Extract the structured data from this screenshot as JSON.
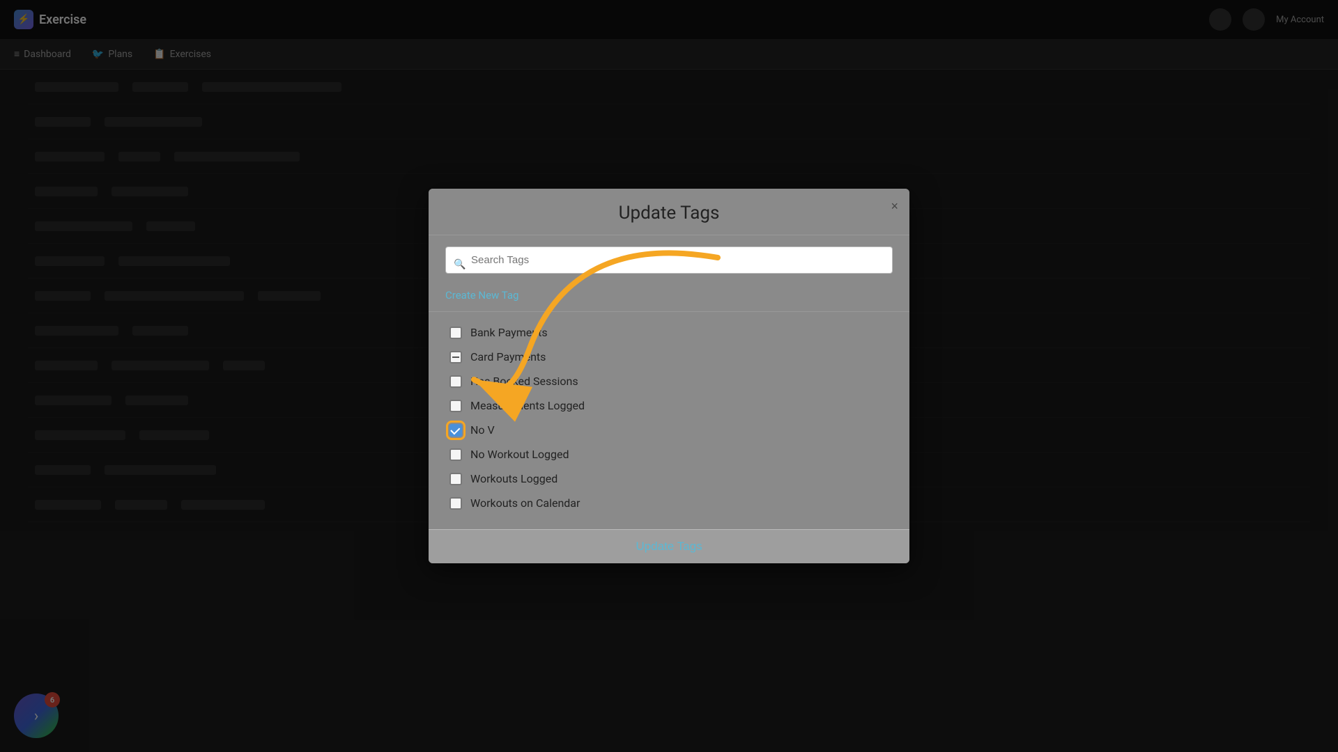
{
  "app": {
    "logo_text": "Exercise",
    "nav_items": [
      {
        "label": "Dashboard",
        "icon": "≡",
        "active": false
      },
      {
        "label": "Plans",
        "icon": "🐦",
        "active": false
      },
      {
        "label": "Exercises",
        "icon": "📋",
        "active": false
      }
    ]
  },
  "modal": {
    "title": "Update Tags",
    "close_label": "×",
    "search_placeholder": "Search Tags",
    "create_new_tag_label": "Create New Tag",
    "tags": [
      {
        "id": "bank-payments",
        "label": "Bank Payments",
        "state": "unchecked"
      },
      {
        "id": "card-payments",
        "label": "Card Payments",
        "state": "indeterminate"
      },
      {
        "id": "has-booked-sessions",
        "label": "Has Booked Sessions",
        "state": "unchecked"
      },
      {
        "id": "measurements-logged",
        "label": "Measurements Logged",
        "state": "unchecked"
      },
      {
        "id": "no-v",
        "label": "No V",
        "state": "checked"
      },
      {
        "id": "no-workout-logged",
        "label": "No Workout Logged",
        "state": "unchecked"
      },
      {
        "id": "workouts-logged",
        "label": "Workouts Logged",
        "state": "unchecked"
      },
      {
        "id": "workouts-on-calendar",
        "label": "Workouts on Calendar",
        "state": "unchecked"
      }
    ],
    "footer_button": "Update Tags"
  },
  "notification": {
    "count": "6"
  },
  "colors": {
    "accent": "#5bb8d4",
    "checked": "#4a90d9",
    "arrow": "#f5a623"
  }
}
